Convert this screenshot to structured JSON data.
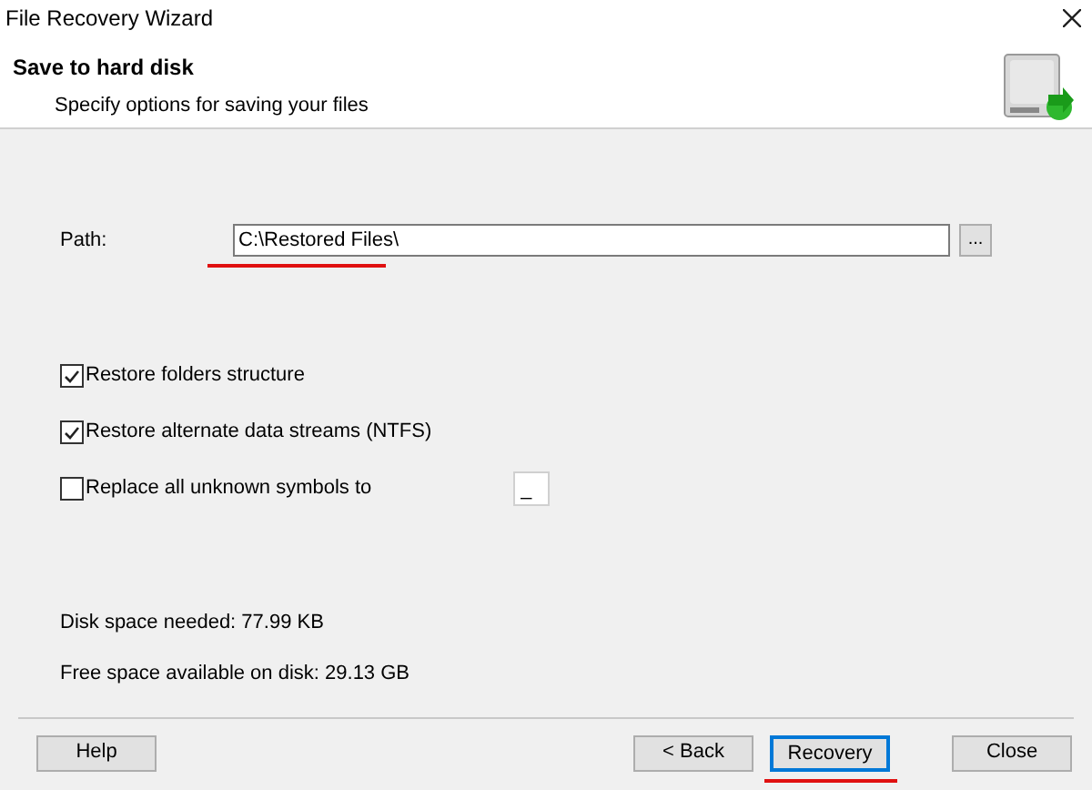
{
  "window": {
    "title": "File Recovery Wizard"
  },
  "header": {
    "title": "Save to hard disk",
    "subtitle": "Specify options for saving your files"
  },
  "path": {
    "label": "Path:",
    "value": "C:\\Restored Files\\",
    "browse": "..."
  },
  "options": [
    {
      "kind": "checkbox",
      "label": "Restore folders structure",
      "checked": true
    },
    {
      "kind": "checkbox",
      "label": "Restore alternate data streams (NTFS)",
      "checked": true
    },
    {
      "kind": "checkbox_field",
      "label": "Replace all unknown symbols to",
      "checked": false,
      "field_value": "_"
    }
  ],
  "disk_info": [
    "Disk space needed: 77.99 KB",
    "Free space available on disk: 29.13 GB"
  ],
  "buttons": [
    {
      "label": "Help",
      "focused": false
    },
    {
      "label": "< Back",
      "focused": false
    },
    {
      "label": "Recovery",
      "focused": true
    },
    {
      "label": "Close",
      "focused": false
    }
  ]
}
